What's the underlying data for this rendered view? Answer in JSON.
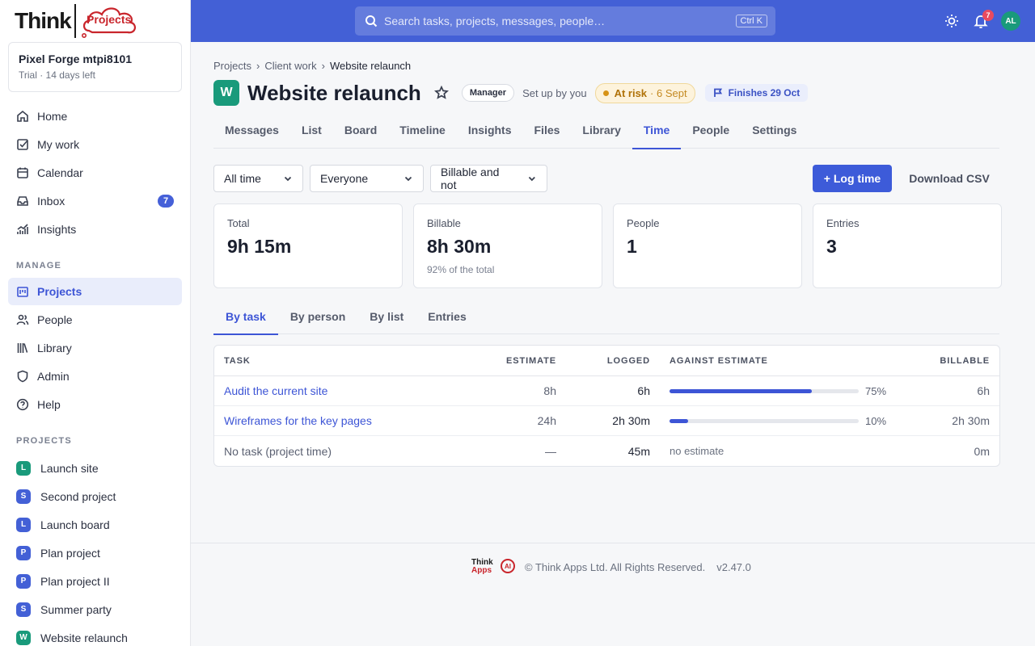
{
  "brand": {
    "logo_text": "Think",
    "logo_product": "Projects"
  },
  "workspace": {
    "name": "Pixel Forge mtpi8101",
    "sub": "Trial · 14 days left"
  },
  "nav_main": [
    {
      "label": "Home",
      "icon": "home-icon"
    },
    {
      "label": "My work",
      "icon": "checkbox-icon"
    },
    {
      "label": "Calendar",
      "icon": "calendar-icon"
    },
    {
      "label": "Inbox",
      "icon": "inbox-icon",
      "badge": "7"
    },
    {
      "label": "Insights",
      "icon": "chart-icon"
    }
  ],
  "manage_label": "MANAGE",
  "nav_manage": [
    {
      "label": "Projects",
      "icon": "projects-icon",
      "active": true
    },
    {
      "label": "People",
      "icon": "people-icon"
    },
    {
      "label": "Library",
      "icon": "library-icon"
    },
    {
      "label": "Admin",
      "icon": "shield-icon"
    },
    {
      "label": "Help",
      "icon": "help-icon"
    }
  ],
  "projects_label": "PROJECTS",
  "projects": [
    {
      "letter": "L",
      "label": "Launch site",
      "color": "#199a7b"
    },
    {
      "letter": "S",
      "label": "Second project",
      "color": "#4360d6"
    },
    {
      "letter": "L",
      "label": "Launch board",
      "color": "#4360d6"
    },
    {
      "letter": "P",
      "label": "Plan project",
      "color": "#4360d6"
    },
    {
      "letter": "P",
      "label": "Plan project II",
      "color": "#4360d6"
    },
    {
      "letter": "S",
      "label": "Summer party",
      "color": "#4360d6"
    },
    {
      "letter": "W",
      "label": "Website relaunch",
      "color": "#199a7b"
    }
  ],
  "topbar": {
    "search_placeholder": "Search tasks, projects, messages, people…",
    "search_kbd": "Ctrl K",
    "notif_count": "7",
    "avatar_initials": "AL"
  },
  "breadcrumb": {
    "root": "Projects",
    "mid": "Client work",
    "current": "Website relaunch",
    "sep": "›"
  },
  "header": {
    "badge_letter": "W",
    "title": "Website relaunch",
    "role": "Manager",
    "setup": "Set up by you",
    "risk_label": "At risk",
    "risk_date": "· 6 Sept",
    "finish": "Finishes 29 Oct"
  },
  "tabs": [
    {
      "label": "Messages"
    },
    {
      "label": "List"
    },
    {
      "label": "Board"
    },
    {
      "label": "Timeline"
    },
    {
      "label": "Insights"
    },
    {
      "label": "Files"
    },
    {
      "label": "Library"
    },
    {
      "label": "Time",
      "active": true
    },
    {
      "label": "People"
    },
    {
      "label": "Settings"
    }
  ],
  "filters": {
    "range": "All time",
    "people": "Everyone",
    "billable": "Billable and not"
  },
  "actions": {
    "log_time": "+ Log time",
    "download_csv": "Download CSV"
  },
  "stats": [
    {
      "label": "Total",
      "value": "9h 15m",
      "sub": ""
    },
    {
      "label": "Billable",
      "value": "8h 30m",
      "sub": "92% of the total"
    },
    {
      "label": "People",
      "value": "1",
      "sub": ""
    },
    {
      "label": "Entries",
      "value": "3",
      "sub": ""
    }
  ],
  "subtabs": [
    {
      "label": "By task",
      "active": true
    },
    {
      "label": "By person"
    },
    {
      "label": "By list"
    },
    {
      "label": "Entries"
    }
  ],
  "table": {
    "headers": {
      "task": "TASK",
      "estimate": "ESTIMATE",
      "logged": "LOGGED",
      "against": "AGAINST ESTIMATE",
      "billable": "BILLABLE"
    },
    "rows": [
      {
        "task": "Audit the current site",
        "link": true,
        "estimate": "8h",
        "logged": "6h",
        "progress": 0.75,
        "pct": "75%",
        "billable": "6h"
      },
      {
        "task": "Wireframes for the key pages",
        "link": true,
        "estimate": "24h",
        "logged": "2h 30m",
        "progress": 0.1,
        "pct": "10%",
        "billable": "2h 30m"
      },
      {
        "task": "No task (project time)",
        "link": false,
        "estimate": "—",
        "logged": "45m",
        "progress": null,
        "note": "no estimate",
        "billable": "0m"
      }
    ]
  },
  "footer": {
    "logo_think": "Think",
    "logo_apps": "Apps",
    "logo_ai": "AI",
    "copyright": "© Think Apps Ltd. All Rights Reserved.",
    "version": "v2.47.0"
  }
}
